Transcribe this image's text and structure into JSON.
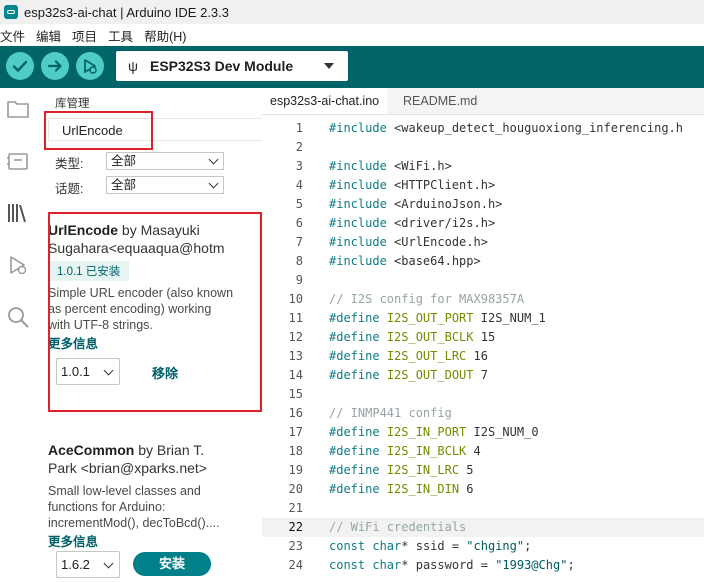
{
  "window": {
    "title": "esp32s3-ai-chat | Arduino IDE 2.3.3"
  },
  "menu": [
    "文件",
    "编辑",
    "项目",
    "工具",
    "帮助(H)"
  ],
  "toolbar": {
    "board": "ESP32S3 Dev Module"
  },
  "colors": {
    "teal_toolbar": "#006468",
    "teal_button": "#4fccc3",
    "accent": "#00818a",
    "highlight_box": "#e0202a"
  },
  "library_manager": {
    "title": "库管理",
    "search_value": "UrlEncode",
    "filters": [
      {
        "label": "类型:",
        "value": "全部"
      },
      {
        "label": "话题:",
        "value": "全部"
      }
    ],
    "cards": [
      {
        "name": "UrlEncode",
        "by": "by Masayuki",
        "author_line": "Sugahara<equaaqua@hotm",
        "installed_badge": "1.0.1 已安装",
        "description": [
          "Simple URL encoder (also known",
          "as percent encoding) working",
          "with UTF-8 strings."
        ],
        "more": "更多信息",
        "version": "1.0.1",
        "action": "移除"
      },
      {
        "name": "AceCommon",
        "by": "by Brian T.",
        "author_line": "Park <brian@xparks.net>",
        "description": [
          "Small low-level classes and",
          "functions for Arduino:",
          "incrementMod(), decToBcd()...."
        ],
        "more": "更多信息",
        "version": "1.6.2",
        "action": "安装"
      }
    ]
  },
  "editor": {
    "tabs": [
      "esp32s3-ai-chat.ino",
      "README.md"
    ],
    "current_line": 22,
    "lines": [
      {
        "n": "1",
        "parts": [
          {
            "t": "#include",
            "c": "kw"
          },
          {
            "t": " <wakeup_detect_houguoxiong_inferencing.h",
            "c": ""
          }
        ]
      },
      {
        "n": "2",
        "parts": []
      },
      {
        "n": "3",
        "parts": [
          {
            "t": "#include",
            "c": "kw"
          },
          {
            "t": " <WiFi.h>",
            "c": ""
          }
        ]
      },
      {
        "n": "4",
        "parts": [
          {
            "t": "#include",
            "c": "kw"
          },
          {
            "t": " <HTTPClient.h>",
            "c": ""
          }
        ]
      },
      {
        "n": "5",
        "parts": [
          {
            "t": "#include",
            "c": "kw"
          },
          {
            "t": " <ArduinoJson.h>",
            "c": ""
          }
        ]
      },
      {
        "n": "6",
        "parts": [
          {
            "t": "#include",
            "c": "kw"
          },
          {
            "t": " <driver/i2s.h>",
            "c": ""
          }
        ]
      },
      {
        "n": "7",
        "parts": [
          {
            "t": "#include",
            "c": "kw"
          },
          {
            "t": " <UrlEncode.h>",
            "c": ""
          }
        ]
      },
      {
        "n": "8",
        "parts": [
          {
            "t": "#include",
            "c": "kw"
          },
          {
            "t": " <base64.hpp>",
            "c": ""
          }
        ]
      },
      {
        "n": "9",
        "parts": []
      },
      {
        "n": "10",
        "parts": [
          {
            "t": "// I2S config for MAX98357A",
            "c": "cm"
          }
        ]
      },
      {
        "n": "11",
        "parts": [
          {
            "t": "#define",
            "c": "kw"
          },
          {
            "t": " ",
            "c": ""
          },
          {
            "t": "I2S_OUT_PORT",
            "c": "dir"
          },
          {
            "t": " I2S_NUM_1",
            "c": ""
          }
        ]
      },
      {
        "n": "12",
        "parts": [
          {
            "t": "#define",
            "c": "kw"
          },
          {
            "t": " ",
            "c": ""
          },
          {
            "t": "I2S_OUT_BCLK",
            "c": "dir"
          },
          {
            "t": " 15",
            "c": ""
          }
        ]
      },
      {
        "n": "13",
        "parts": [
          {
            "t": "#define",
            "c": "kw"
          },
          {
            "t": " ",
            "c": ""
          },
          {
            "t": "I2S_OUT_LRC",
            "c": "dir"
          },
          {
            "t": " 16",
            "c": ""
          }
        ]
      },
      {
        "n": "14",
        "parts": [
          {
            "t": "#define",
            "c": "kw"
          },
          {
            "t": " ",
            "c": ""
          },
          {
            "t": "I2S_OUT_DOUT",
            "c": "dir"
          },
          {
            "t": " 7",
            "c": ""
          }
        ]
      },
      {
        "n": "15",
        "parts": []
      },
      {
        "n": "16",
        "parts": [
          {
            "t": "// INMP441 config",
            "c": "cm"
          }
        ]
      },
      {
        "n": "17",
        "parts": [
          {
            "t": "#define",
            "c": "kw"
          },
          {
            "t": " ",
            "c": ""
          },
          {
            "t": "I2S_IN_PORT",
            "c": "dir"
          },
          {
            "t": " I2S_NUM_0",
            "c": ""
          }
        ]
      },
      {
        "n": "18",
        "parts": [
          {
            "t": "#define",
            "c": "kw"
          },
          {
            "t": " ",
            "c": ""
          },
          {
            "t": "I2S_IN_BCLK",
            "c": "dir"
          },
          {
            "t": " 4",
            "c": ""
          }
        ]
      },
      {
        "n": "19",
        "parts": [
          {
            "t": "#define",
            "c": "kw"
          },
          {
            "t": " ",
            "c": ""
          },
          {
            "t": "I2S_IN_LRC",
            "c": "dir"
          },
          {
            "t": " 5",
            "c": ""
          }
        ]
      },
      {
        "n": "20",
        "parts": [
          {
            "t": "#define",
            "c": "kw"
          },
          {
            "t": " ",
            "c": ""
          },
          {
            "t": "I2S_IN_DIN",
            "c": "dir"
          },
          {
            "t": " 6",
            "c": ""
          }
        ]
      },
      {
        "n": "21",
        "parts": []
      },
      {
        "n": "22",
        "parts": [
          {
            "t": "// WiFi credentials",
            "c": "cm"
          }
        ]
      },
      {
        "n": "23",
        "parts": [
          {
            "t": "const",
            "c": "kw"
          },
          {
            "t": " ",
            "c": ""
          },
          {
            "t": "char",
            "c": "kw"
          },
          {
            "t": "* ssid = ",
            "c": ""
          },
          {
            "t": "\"chging\"",
            "c": "str"
          },
          {
            "t": ";",
            "c": ""
          }
        ]
      },
      {
        "n": "24",
        "parts": [
          {
            "t": "const",
            "c": "kw"
          },
          {
            "t": " ",
            "c": ""
          },
          {
            "t": "char",
            "c": "kw"
          },
          {
            "t": "* password = ",
            "c": ""
          },
          {
            "t": "\"1993@Chg\"",
            "c": "str"
          },
          {
            "t": ";",
            "c": ""
          }
        ]
      }
    ]
  }
}
